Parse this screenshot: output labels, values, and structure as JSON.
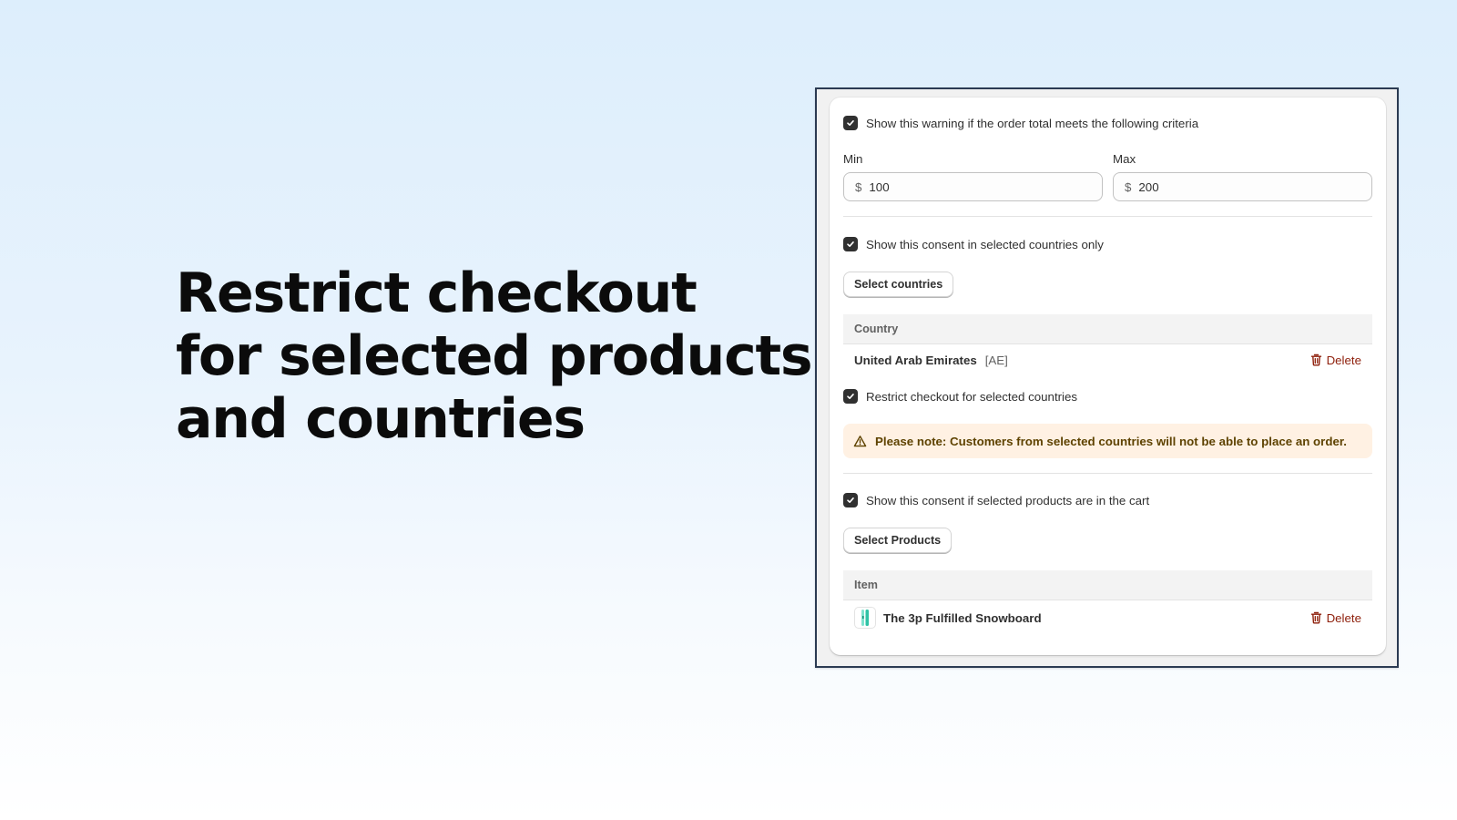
{
  "headline": {
    "lines": [
      "Restrict checkout",
      "for selected products",
      "and countries"
    ]
  },
  "order_total": {
    "checkbox_label": "Show this warning if the order total meets the following criteria",
    "checked": true,
    "min": {
      "label": "Min",
      "prefix": "$",
      "value": "100"
    },
    "max": {
      "label": "Max",
      "prefix": "$",
      "value": "200"
    }
  },
  "countries": {
    "checkbox_label": "Show this consent in selected countries only",
    "checked": true,
    "select_button_label": "Select countries",
    "table_header": "Country",
    "rows": [
      {
        "name": "United Arab Emirates",
        "code": "[AE]",
        "delete_label": "Delete"
      }
    ],
    "restrict_checkbox_label": "Restrict checkout for selected countries",
    "restrict_checked": true,
    "warning_text": "Please note: Customers from selected countries will not be able to place an order.",
    "warning_icon": "alert-triangle-icon"
  },
  "products": {
    "checkbox_label": "Show this consent if selected products are in the cart",
    "checked": true,
    "select_button_label": "Select Products",
    "table_header": "Item",
    "rows": [
      {
        "name": "The 3p Fulfilled Snowboard",
        "thumbnail_icon": "snowboard-thumbnail",
        "delete_label": "Delete"
      }
    ]
  },
  "colors": {
    "checkbox": "#303030",
    "delete": "#8e1f0b",
    "warning_bg": "#fff1e3",
    "warning_text": "#5e4200",
    "frame_border": "#2b3a52"
  }
}
